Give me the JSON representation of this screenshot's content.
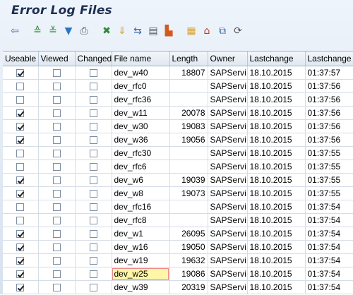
{
  "title": "Error Log Files",
  "toolbar": [
    {
      "name": "details-icon",
      "glyph": "⇦",
      "color": "#3a6ab0"
    },
    {
      "name": "sort-ascending-icon",
      "glyph": "≙",
      "color": "#2f8a3a"
    },
    {
      "name": "sort-descending-icon",
      "glyph": "≚",
      "color": "#2f8a3a"
    },
    {
      "name": "filter-icon",
      "glyph": "▼",
      "color": "#2a74c6"
    },
    {
      "name": "print-icon",
      "glyph": "⎙",
      "color": "#555"
    },
    {
      "name": "export-icon",
      "glyph": "✖",
      "color": "#2f8a3a"
    },
    {
      "name": "download-icon",
      "glyph": "⇓",
      "color": "#d4a018"
    },
    {
      "name": "transfer-icon",
      "glyph": "⇆",
      "color": "#3a6ab0"
    },
    {
      "name": "layout-icon",
      "glyph": "▤",
      "color": "#555"
    },
    {
      "name": "chart-icon",
      "glyph": "▙",
      "color": "#d35a1e"
    },
    {
      "name": "table-icon",
      "glyph": "▦",
      "color": "#e0a020"
    },
    {
      "name": "send-icon",
      "glyph": "⌂",
      "color": "#c0392b"
    },
    {
      "name": "save-layout-icon",
      "glyph": "⧉",
      "color": "#3a6ab0"
    },
    {
      "name": "settings-icon",
      "glyph": "⟳",
      "color": "#555"
    }
  ],
  "columns": [
    "Useable",
    "Viewed",
    "Changed",
    "File name",
    "Length",
    "Owner",
    "Lastchange",
    "Lastchange"
  ],
  "rows": [
    {
      "useable": true,
      "viewed": false,
      "changed": false,
      "file": "dev_w40",
      "length": "18807",
      "owner": "SAPServi",
      "date": "18.10.2015",
      "time": "01:37:57"
    },
    {
      "useable": false,
      "viewed": false,
      "changed": false,
      "file": "dev_rfc0",
      "length": "",
      "owner": "SAPServi",
      "date": "18.10.2015",
      "time": "01:37:56"
    },
    {
      "useable": false,
      "viewed": false,
      "changed": false,
      "file": "dev_rfc36",
      "length": "",
      "owner": "SAPServi",
      "date": "18.10.2015",
      "time": "01:37:56"
    },
    {
      "useable": true,
      "viewed": false,
      "changed": false,
      "file": "dev_w11",
      "length": "20078",
      "owner": "SAPServi",
      "date": "18.10.2015",
      "time": "01:37:56"
    },
    {
      "useable": true,
      "viewed": false,
      "changed": false,
      "file": "dev_w30",
      "length": "19083",
      "owner": "SAPServi",
      "date": "18.10.2015",
      "time": "01:37:56"
    },
    {
      "useable": true,
      "viewed": false,
      "changed": false,
      "file": "dev_w36",
      "length": "19056",
      "owner": "SAPServi",
      "date": "18.10.2015",
      "time": "01:37:56"
    },
    {
      "useable": false,
      "viewed": false,
      "changed": false,
      "file": "dev_rfc30",
      "length": "",
      "owner": "SAPServi",
      "date": "18.10.2015",
      "time": "01:37:55"
    },
    {
      "useable": false,
      "viewed": false,
      "changed": false,
      "file": "dev_rfc6",
      "length": "",
      "owner": "SAPServi",
      "date": "18.10.2015",
      "time": "01:37:55"
    },
    {
      "useable": true,
      "viewed": false,
      "changed": false,
      "file": "dev_w6",
      "length": "19039",
      "owner": "SAPServi",
      "date": "18.10.2015",
      "time": "01:37:55"
    },
    {
      "useable": true,
      "viewed": false,
      "changed": false,
      "file": "dev_w8",
      "length": "19073",
      "owner": "SAPServi",
      "date": "18.10.2015",
      "time": "01:37:55"
    },
    {
      "useable": false,
      "viewed": false,
      "changed": false,
      "file": "dev_rfc16",
      "length": "",
      "owner": "SAPServi",
      "date": "18.10.2015",
      "time": "01:37:54"
    },
    {
      "useable": false,
      "viewed": false,
      "changed": false,
      "file": "dev_rfc8",
      "length": "",
      "owner": "SAPServi",
      "date": "18.10.2015",
      "time": "01:37:54"
    },
    {
      "useable": true,
      "viewed": false,
      "changed": false,
      "file": "dev_w1",
      "length": "26095",
      "owner": "SAPServi",
      "date": "18.10.2015",
      "time": "01:37:54"
    },
    {
      "useable": true,
      "viewed": false,
      "changed": false,
      "file": "dev_w16",
      "length": "19050",
      "owner": "SAPServi",
      "date": "18.10.2015",
      "time": "01:37:54"
    },
    {
      "useable": true,
      "viewed": false,
      "changed": false,
      "file": "dev_w19",
      "length": "19632",
      "owner": "SAPServi",
      "date": "18.10.2015",
      "time": "01:37:54"
    },
    {
      "useable": true,
      "viewed": false,
      "changed": false,
      "file": "dev_w25",
      "length": "19086",
      "owner": "SAPServi",
      "date": "18.10.2015",
      "time": "01:37:54",
      "focused": true
    },
    {
      "useable": true,
      "viewed": false,
      "changed": false,
      "file": "dev_w39",
      "length": "20319",
      "owner": "SAPServi",
      "date": "18.10.2015",
      "time": "01:37:54"
    }
  ]
}
